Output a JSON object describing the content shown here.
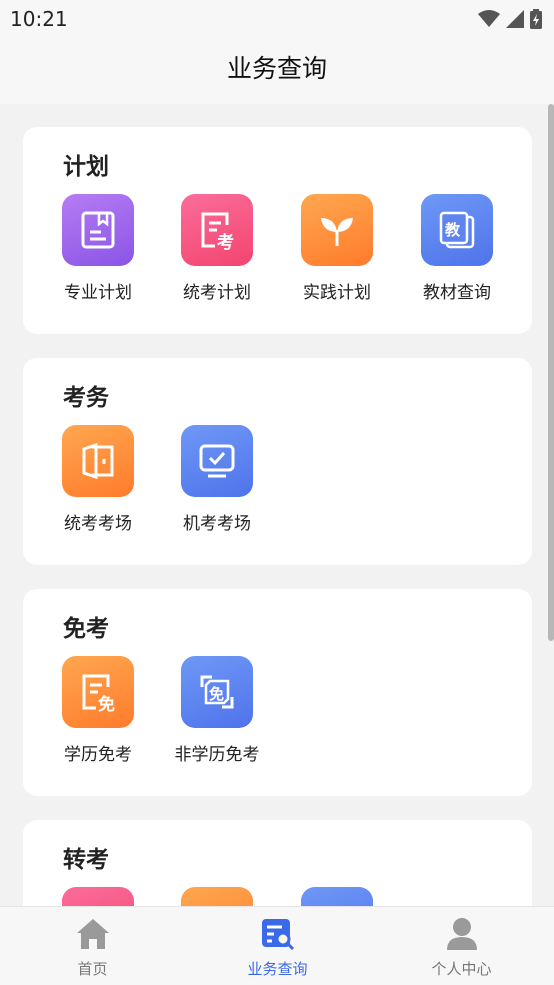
{
  "status": {
    "time": "10:21"
  },
  "header": {
    "title": "业务查询"
  },
  "sections": [
    {
      "title": "计划",
      "items": [
        {
          "label": "专业计划",
          "icon": "book-icon",
          "color": "#9b66ee"
        },
        {
          "label": "统考计划",
          "icon": "exam-doc-icon",
          "color": "#f55a83"
        },
        {
          "label": "实践计划",
          "icon": "sprout-icon",
          "color": "#ff8e3a"
        },
        {
          "label": "教材查询",
          "icon": "textbook-icon",
          "color": "#5e84f0"
        }
      ]
    },
    {
      "title": "考务",
      "items": [
        {
          "label": "统考考场",
          "icon": "door-icon",
          "color": "#ff8e3a"
        },
        {
          "label": "机考考场",
          "icon": "monitor-check-icon",
          "color": "#5e84f0"
        }
      ]
    },
    {
      "title": "免考",
      "items": [
        {
          "label": "学历免考",
          "icon": "exempt-doc-icon",
          "color": "#ff8e3a"
        },
        {
          "label": "非学历免考",
          "icon": "exempt-badge-icon",
          "color": "#5e84f0"
        }
      ]
    },
    {
      "title": "转考",
      "items": []
    }
  ],
  "tabbar": {
    "tabs": [
      {
        "label": "首页",
        "icon": "home-icon",
        "active": false
      },
      {
        "label": "业务查询",
        "icon": "business-search-icon",
        "active": true
      },
      {
        "label": "个人中心",
        "icon": "person-icon",
        "active": false
      }
    ],
    "active_color": "#3a6ae8",
    "inactive_color": "#777777"
  }
}
